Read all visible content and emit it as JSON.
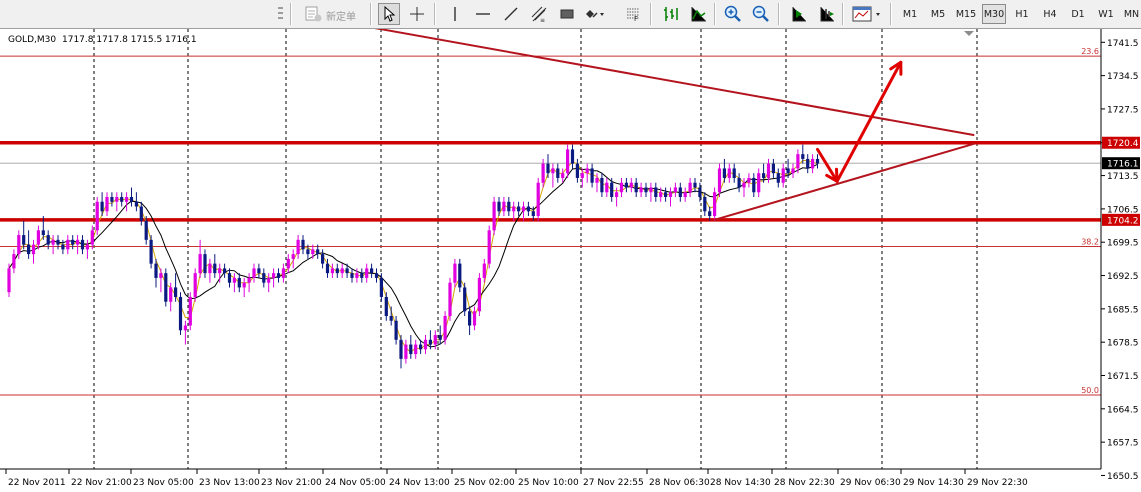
{
  "toolbar": {
    "new_order_label": "新定单",
    "timeframes": [
      "M1",
      "M5",
      "M15",
      "M30",
      "H1",
      "H4",
      "D1",
      "W1",
      "MN"
    ],
    "active_timeframe": "M30"
  },
  "chart_header": {
    "symbol": "GOLD,M30",
    "ohlc": "1717.8 1717.8 1715.5 1716.1"
  },
  "colors": {
    "bull_candle": "#e000e0",
    "bear_candle": "#0a1a80",
    "level_line": "#cc0000",
    "fib_line": "#c83232",
    "trend_line": "#b4141e",
    "ma_line": "#000000",
    "ma_fast_line": "#d4a400",
    "arrow": "#e00000",
    "current_price_bg": "#000000"
  },
  "chart_data": {
    "type": "candlestick",
    "title": "",
    "ylim": [
      1647.4,
      1744.6
    ],
    "price_axis_ticks": [
      "1741.5",
      "1734.5",
      "1727.5",
      "1720.4",
      "1713.5",
      "1706.5",
      "1699.5",
      "1692.5",
      "1685.5",
      "1678.5",
      "1671.5",
      "1664.5",
      "1657.5",
      "1650.5"
    ],
    "time_axis_labels": [
      "22 Nov 2011",
      "22 Nov 21:00",
      "23 Nov 05:00",
      "23 Nov 13:00",
      "23 Nov 21:00",
      "24 Nov 05:00",
      "24 Nov 13:00",
      "25 Nov 02:00",
      "25 Nov 10:00",
      "27 Nov 22:55",
      "28 Nov 06:30",
      "28 Nov 14:30",
      "28 Nov 22:30",
      "29 Nov 06:30",
      "29 Nov 14:30",
      "29 Nov 22:30"
    ],
    "grid": "vertical-dashed",
    "horizontal_levels": [
      {
        "price": 1720.4,
        "label": "1720.4",
        "style": "thick"
      },
      {
        "price": 1704.2,
        "label": "1704.2",
        "style": "thick"
      }
    ],
    "fib_levels": [
      {
        "price": 1738.6,
        "label": "23.6"
      },
      {
        "price": 1698.6,
        "label": "38.2"
      },
      {
        "price": 1667.4,
        "label": "50.0"
      }
    ],
    "current_price": {
      "price": 1716.1,
      "label": "1716.1"
    },
    "trendlines": [
      {
        "from": {
          "index": 73,
          "price": 1744.8
        },
        "to": {
          "index": 197,
          "price": 1722.0
        }
      },
      {
        "from": {
          "index": 144,
          "price": 1704.2
        },
        "to": {
          "index": 197,
          "price": 1720.2
        }
      }
    ],
    "annotation_arrows": [
      {
        "points": [
          {
            "index": 165,
            "price": 1719.0
          },
          {
            "index": 169,
            "price": 1712.3
          }
        ],
        "head": "end"
      },
      {
        "points": [
          {
            "index": 169,
            "price": 1712.3
          },
          {
            "index": 182,
            "price": 1737.3
          }
        ],
        "head": "end"
      }
    ],
    "candles": [
      [
        1689,
        1695,
        1688,
        1694
      ],
      [
        1694,
        1698,
        1693,
        1697
      ],
      [
        1697,
        1702,
        1696,
        1701
      ],
      [
        1701,
        1704,
        1698,
        1699
      ],
      [
        1699,
        1702,
        1696,
        1697
      ],
      [
        1697,
        1700,
        1695,
        1699
      ],
      [
        1699,
        1703,
        1698,
        1702
      ],
      [
        1702,
        1705,
        1700,
        1701
      ],
      [
        1701,
        1702,
        1698,
        1699
      ],
      [
        1699,
        1701,
        1697,
        1700
      ],
      [
        1700,
        1701,
        1698,
        1699
      ],
      [
        1699,
        1700,
        1697,
        1698
      ],
      [
        1698,
        1701,
        1697,
        1700
      ],
      [
        1700,
        1701,
        1698,
        1699
      ],
      [
        1699,
        1701,
        1697,
        1700
      ],
      [
        1700,
        1701,
        1697,
        1698
      ],
      [
        1698,
        1700,
        1696,
        1699
      ],
      [
        1699,
        1703,
        1698,
        1702
      ],
      [
        1702,
        1709,
        1701,
        1708
      ],
      [
        1708,
        1710,
        1705,
        1706
      ],
      [
        1706,
        1710,
        1705,
        1709
      ],
      [
        1709,
        1710,
        1707,
        1708
      ],
      [
        1708,
        1710,
        1706,
        1709
      ],
      [
        1709,
        1710,
        1707,
        1708
      ],
      [
        1708,
        1710,
        1706,
        1709
      ],
      [
        1709,
        1711,
        1707,
        1708
      ],
      [
        1708,
        1710,
        1706,
        1707
      ],
      [
        1707,
        1708,
        1703,
        1704
      ],
      [
        1704,
        1705,
        1699,
        1700
      ],
      [
        1700,
        1701,
        1694,
        1695
      ],
      [
        1695,
        1696,
        1690,
        1692
      ],
      [
        1692,
        1694,
        1689,
        1693
      ],
      [
        1693,
        1694,
        1686,
        1687
      ],
      [
        1687,
        1691,
        1685,
        1690
      ],
      [
        1690,
        1693,
        1687,
        1688
      ],
      [
        1688,
        1689,
        1680,
        1681
      ],
      [
        1681,
        1683,
        1678,
        1682
      ],
      [
        1682,
        1689,
        1681,
        1688
      ],
      [
        1688,
        1694,
        1687,
        1693
      ],
      [
        1693,
        1700,
        1692,
        1697
      ],
      [
        1697,
        1698,
        1692,
        1693
      ],
      [
        1693,
        1696,
        1691,
        1695
      ],
      [
        1695,
        1697,
        1692,
        1693
      ],
      [
        1693,
        1695,
        1691,
        1694
      ],
      [
        1694,
        1695,
        1692,
        1693
      ],
      [
        1693,
        1694,
        1690,
        1691
      ],
      [
        1691,
        1693,
        1689,
        1692
      ],
      [
        1692,
        1693,
        1689,
        1690
      ],
      [
        1690,
        1692,
        1688,
        1691
      ],
      [
        1691,
        1693,
        1689,
        1692
      ],
      [
        1692,
        1695,
        1691,
        1694
      ],
      [
        1694,
        1695,
        1692,
        1693
      ],
      [
        1693,
        1694,
        1690,
        1691
      ],
      [
        1691,
        1693,
        1689,
        1692
      ],
      [
        1692,
        1694,
        1690,
        1693
      ],
      [
        1693,
        1694,
        1691,
        1692
      ],
      [
        1692,
        1695,
        1691,
        1694
      ],
      [
        1694,
        1697,
        1693,
        1696
      ],
      [
        1696,
        1698,
        1694,
        1697
      ],
      [
        1697,
        1701,
        1696,
        1700
      ],
      [
        1700,
        1701,
        1697,
        1698
      ],
      [
        1698,
        1699,
        1696,
        1697
      ],
      [
        1697,
        1699,
        1696,
        1698
      ],
      [
        1698,
        1699,
        1696,
        1697
      ],
      [
        1697,
        1698,
        1694,
        1695
      ],
      [
        1695,
        1696,
        1692,
        1693
      ],
      [
        1693,
        1695,
        1692,
        1694
      ],
      [
        1694,
        1695,
        1692,
        1693
      ],
      [
        1693,
        1695,
        1692,
        1694
      ],
      [
        1694,
        1695,
        1692,
        1693
      ],
      [
        1693,
        1694,
        1691,
        1692
      ],
      [
        1692,
        1694,
        1691,
        1693
      ],
      [
        1693,
        1694,
        1691,
        1692
      ],
      [
        1692,
        1695,
        1691,
        1694
      ],
      [
        1694,
        1695,
        1692,
        1693
      ],
      [
        1693,
        1694,
        1691,
        1692
      ],
      [
        1692,
        1693,
        1687,
        1688
      ],
      [
        1688,
        1689,
        1683,
        1684
      ],
      [
        1684,
        1686,
        1682,
        1683
      ],
      [
        1683,
        1684,
        1678,
        1679
      ],
      [
        1679,
        1680,
        1673,
        1675
      ],
      [
        1675,
        1679,
        1674,
        1678
      ],
      [
        1678,
        1680,
        1675,
        1676
      ],
      [
        1676,
        1679,
        1675,
        1678
      ],
      [
        1678,
        1679,
        1676,
        1677
      ],
      [
        1677,
        1680,
        1676,
        1679
      ],
      [
        1679,
        1681,
        1677,
        1678
      ],
      [
        1678,
        1681,
        1677,
        1680
      ],
      [
        1680,
        1682,
        1678,
        1679
      ],
      [
        1679,
        1685,
        1678,
        1684
      ],
      [
        1684,
        1692,
        1683,
        1691
      ],
      [
        1691,
        1696,
        1690,
        1695
      ],
      [
        1695,
        1696,
        1689,
        1690
      ],
      [
        1690,
        1691,
        1684,
        1685
      ],
      [
        1685,
        1686,
        1680,
        1682
      ],
      [
        1682,
        1686,
        1681,
        1685
      ],
      [
        1685,
        1693,
        1684,
        1692
      ],
      [
        1692,
        1696,
        1691,
        1695
      ],
      [
        1695,
        1703,
        1694,
        1702
      ],
      [
        1702,
        1709,
        1701,
        1708
      ],
      [
        1708,
        1709,
        1705,
        1706
      ],
      [
        1706,
        1709,
        1705,
        1708
      ],
      [
        1708,
        1709,
        1705,
        1706
      ],
      [
        1706,
        1708,
        1704,
        1707
      ],
      [
        1707,
        1708,
        1705,
        1706
      ],
      [
        1706,
        1708,
        1704,
        1707
      ],
      [
        1707,
        1708,
        1705,
        1706
      ],
      [
        1706,
        1707,
        1704,
        1705
      ],
      [
        1705,
        1713,
        1704,
        1712
      ],
      [
        1712,
        1717,
        1711,
        1716
      ],
      [
        1716,
        1718,
        1713,
        1714
      ],
      [
        1714,
        1716,
        1711,
        1715
      ],
      [
        1715,
        1716,
        1712,
        1713
      ],
      [
        1713,
        1715,
        1712,
        1714
      ],
      [
        1714,
        1720,
        1713,
        1719
      ],
      [
        1719,
        1720,
        1715,
        1716
      ],
      [
        1716,
        1717,
        1712,
        1713
      ],
      [
        1713,
        1715,
        1711,
        1714
      ],
      [
        1714,
        1716,
        1712,
        1715
      ],
      [
        1715,
        1716,
        1711,
        1712
      ],
      [
        1712,
        1714,
        1710,
        1713
      ],
      [
        1713,
        1714,
        1709,
        1710
      ],
      [
        1710,
        1713,
        1709,
        1712
      ],
      [
        1712,
        1713,
        1708,
        1709
      ],
      [
        1709,
        1711,
        1707,
        1710
      ],
      [
        1710,
        1713,
        1709,
        1712
      ],
      [
        1712,
        1713,
        1710,
        1711
      ],
      [
        1711,
        1713,
        1710,
        1712
      ],
      [
        1712,
        1713,
        1709,
        1710
      ],
      [
        1710,
        1712,
        1709,
        1711
      ],
      [
        1711,
        1712,
        1709,
        1710
      ],
      [
        1710,
        1712,
        1708,
        1711
      ],
      [
        1711,
        1712,
        1708,
        1709
      ],
      [
        1709,
        1711,
        1708,
        1710
      ],
      [
        1710,
        1711,
        1708,
        1709
      ],
      [
        1709,
        1711,
        1707,
        1710
      ],
      [
        1710,
        1712,
        1709,
        1711
      ],
      [
        1711,
        1712,
        1708,
        1709
      ],
      [
        1709,
        1711,
        1708,
        1710
      ],
      [
        1710,
        1713,
        1709,
        1712
      ],
      [
        1712,
        1713,
        1710,
        1711
      ],
      [
        1711,
        1712,
        1708,
        1709
      ],
      [
        1709,
        1710,
        1705,
        1706
      ],
      [
        1706,
        1707,
        1704,
        1705
      ],
      [
        1705,
        1711,
        1704,
        1710
      ],
      [
        1710,
        1716,
        1709,
        1715
      ],
      [
        1715,
        1717,
        1712,
        1713
      ],
      [
        1713,
        1716,
        1712,
        1715
      ],
      [
        1715,
        1716,
        1712,
        1713
      ],
      [
        1713,
        1714,
        1710,
        1711
      ],
      [
        1711,
        1713,
        1709,
        1712
      ],
      [
        1712,
        1714,
        1711,
        1713
      ],
      [
        1713,
        1714,
        1709,
        1710
      ],
      [
        1710,
        1715,
        1709,
        1714
      ],
      [
        1714,
        1716,
        1712,
        1713
      ],
      [
        1713,
        1717,
        1712,
        1716
      ],
      [
        1716,
        1717,
        1713,
        1714
      ],
      [
        1714,
        1715,
        1711,
        1712
      ],
      [
        1712,
        1716,
        1711,
        1715
      ],
      [
        1715,
        1717,
        1713,
        1714
      ],
      [
        1714,
        1716,
        1713,
        1715
      ],
      [
        1715,
        1719,
        1714,
        1718
      ],
      [
        1718,
        1720,
        1716,
        1717
      ],
      [
        1717,
        1718,
        1714,
        1715
      ],
      [
        1715,
        1718,
        1714,
        1717
      ],
      [
        1717,
        1718,
        1715,
        1716
      ]
    ]
  }
}
